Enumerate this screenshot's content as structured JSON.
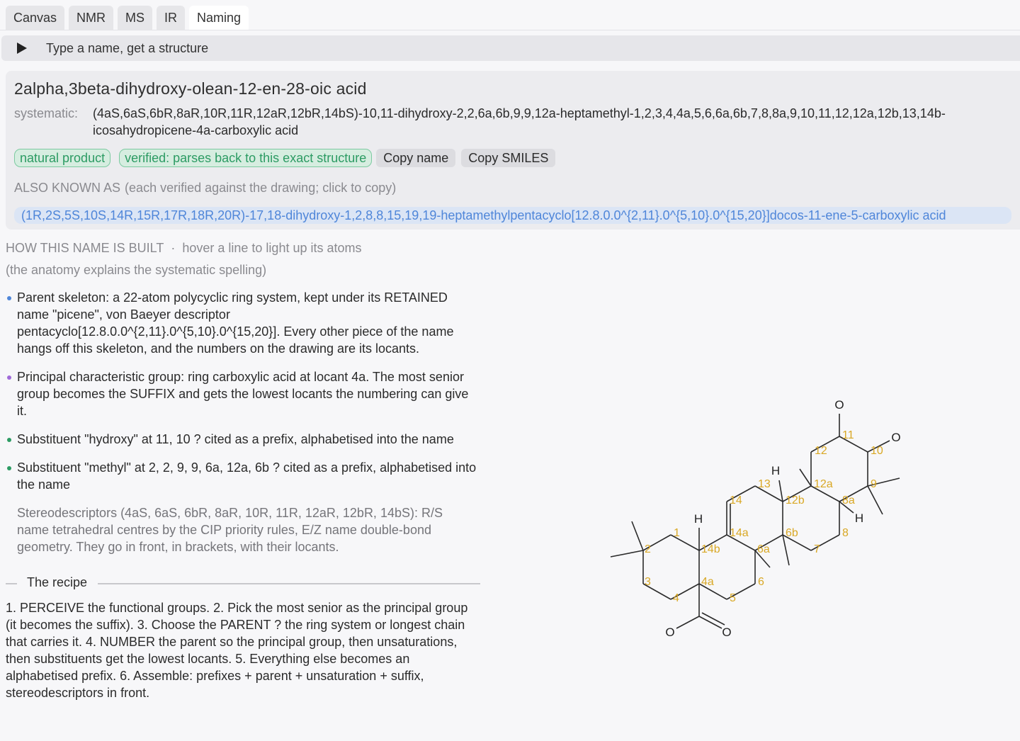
{
  "tabs": [
    "Canvas",
    "NMR",
    "MS",
    "IR",
    "Naming"
  ],
  "active_tab": "Naming",
  "summary_text": "Type a name, get a structure",
  "result": {
    "name": "2alpha,3beta-dihydroxy-olean-12-en-28-oic acid",
    "systematic_label": "systematic:",
    "systematic": "(4aS,6aS,6bR,8aR,10R,11R,12aR,12bR,14bS)-10,11-dihydroxy-2,2,6a,6b,9,9,12a-heptamethyl-1,2,3,4,4a,5,6,6a,6b,7,8,8a,9,10,11,12,12a,12b,13,14b-icosahydropicene-4a-carboxylic acid",
    "badges": [
      "natural product",
      "verified: parses back to this exact structure"
    ],
    "copy_name": "Copy name",
    "copy_smiles": "Copy SMILES",
    "aka_title": "ALSO KNOWN AS",
    "aka_note": "(each verified against the drawing; click to copy)",
    "aka_names": [
      "(1R,2S,5S,10S,14R,15R,17R,18R,20R)-17,18-dihydroxy-1,2,8,8,15,19,19-heptamethylpentacyclo[12.8.0.0^{2,11}.0^{5,10}.0^{15,20}]docos-11-ene-5-carboxylic acid"
    ]
  },
  "anatomy": {
    "title": "HOW THIS NAME IS BUILT",
    "separator": "·",
    "hint": "hover a line to light up its atoms",
    "subtitle": "(the anatomy explains the systematic spelling)",
    "bullets": [
      {
        "text": "Parent skeleton: a 22-atom polycyclic ring system, kept under its RETAINED name \"picene\", von Baeyer descriptor pentacyclo[12.8.0.0^{2,11}.0^{5,10}.0^{15,20}]. Every other piece of the name hangs off this skeleton, and the numbers on the drawing are its locants.",
        "color": "#4f86d9"
      },
      {
        "text": "Principal characteristic group: ring carboxylic acid at locant 4a. The most senior group becomes the SUFFIX and gets the lowest locants the numbering can give it.",
        "color": "#a06ad9"
      },
      {
        "text": "Substituent \"hydroxy\" at 11, 10 ? cited as a prefix, alphabetised into the name",
        "color": "#2c9b63"
      },
      {
        "text": "Substituent \"methyl\" at 2, 2, 9, 9, 6a, 12a, 6b ? cited as a prefix, alphabetised into the name",
        "color": "#2c9b63"
      }
    ],
    "stereo": "Stereodescriptors (4aS, 6aS, 6bR, 8aR, 10R, 11R, 12aR, 12bR, 14bS): R/S name tetrahedral centres by the CIP priority rules, E/Z name double-bond geometry. They go in front, in brackets, with their locants."
  },
  "recipe": {
    "title": "The recipe",
    "text": "1. PERCEIVE the functional groups.  2. Pick the most senior as the principal group (it becomes the suffix).  3. Choose the PARENT ? the ring system or longest chain that carries it.  4. NUMBER the parent so the principal group, then unsaturations, then substituents get the lowest locants.  5. Everything else becomes an alphabetised prefix.  6. Assemble: prefixes + parent + unsaturation + suffix, stereodescriptors in front."
  },
  "structure": {
    "atom_labels": [
      "O",
      "O",
      "H",
      "H",
      "H",
      "O",
      "O"
    ],
    "locants": [
      "1",
      "2",
      "3",
      "4",
      "4a",
      "5",
      "6",
      "6a",
      "6b",
      "7",
      "8",
      "8a",
      "9",
      "10",
      "11",
      "12",
      "12a",
      "12b",
      "13",
      "14",
      "14a",
      "14b"
    ],
    "locant_color": "#d9a825"
  }
}
